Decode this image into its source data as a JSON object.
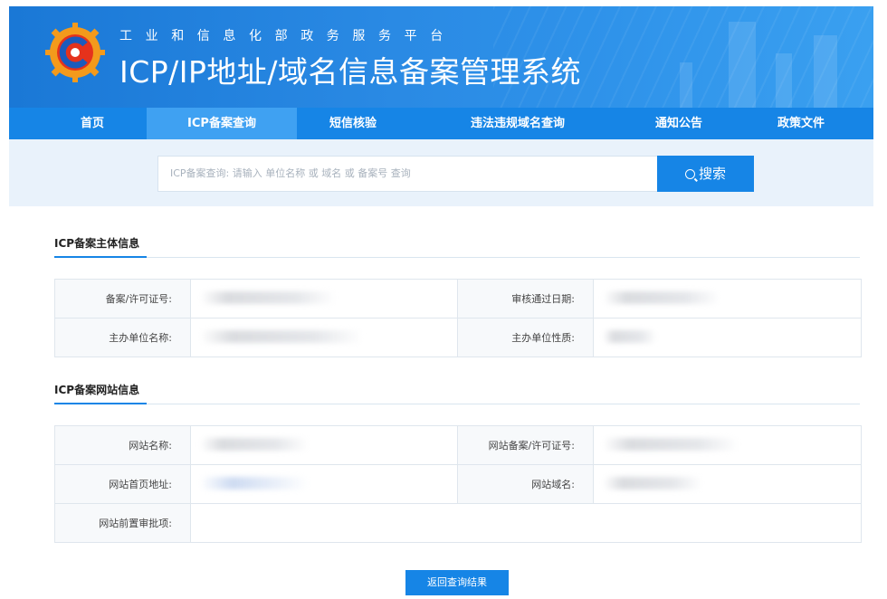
{
  "header": {
    "subtitle": "工业和信息化部政务服务平台",
    "title": "ICP/IP地址/域名信息备案管理系统"
  },
  "nav": {
    "items": [
      {
        "label": "首页"
      },
      {
        "label": "ICP备案查询",
        "active": true
      },
      {
        "label": "短信核验"
      },
      {
        "label": "违法违规域名查询"
      },
      {
        "label": "通知公告"
      },
      {
        "label": "政策文件"
      }
    ]
  },
  "search": {
    "placeholder": "ICP备案查询: 请输入 单位名称 或 域名 或 备案号 查询",
    "button_label": "搜索",
    "button_icon": "search-icon"
  },
  "subject_section": {
    "title": "ICP备案主体信息",
    "rows": [
      [
        {
          "label": "备案/许可证号:",
          "value": ""
        },
        {
          "label": "审核通过日期:",
          "value": ""
        }
      ],
      [
        {
          "label": "主办单位名称:",
          "value": ""
        },
        {
          "label": "主办单位性质:",
          "value": ""
        }
      ]
    ]
  },
  "website_section": {
    "title": "ICP备案网站信息",
    "rows": [
      [
        {
          "label": "网站名称:",
          "value": ""
        },
        {
          "label": "网站备案/许可证号:",
          "value": ""
        }
      ],
      [
        {
          "label": "网站首页地址:",
          "value": ""
        },
        {
          "label": "网站域名:",
          "value": ""
        }
      ],
      [
        {
          "label": "网站前置审批项:",
          "value": ""
        }
      ]
    ]
  },
  "footer": {
    "back_label": "返回查询结果"
  },
  "colors": {
    "primary": "#1685e6",
    "nav_active": "#3fa1f2",
    "search_band": "#e9f2fb"
  }
}
